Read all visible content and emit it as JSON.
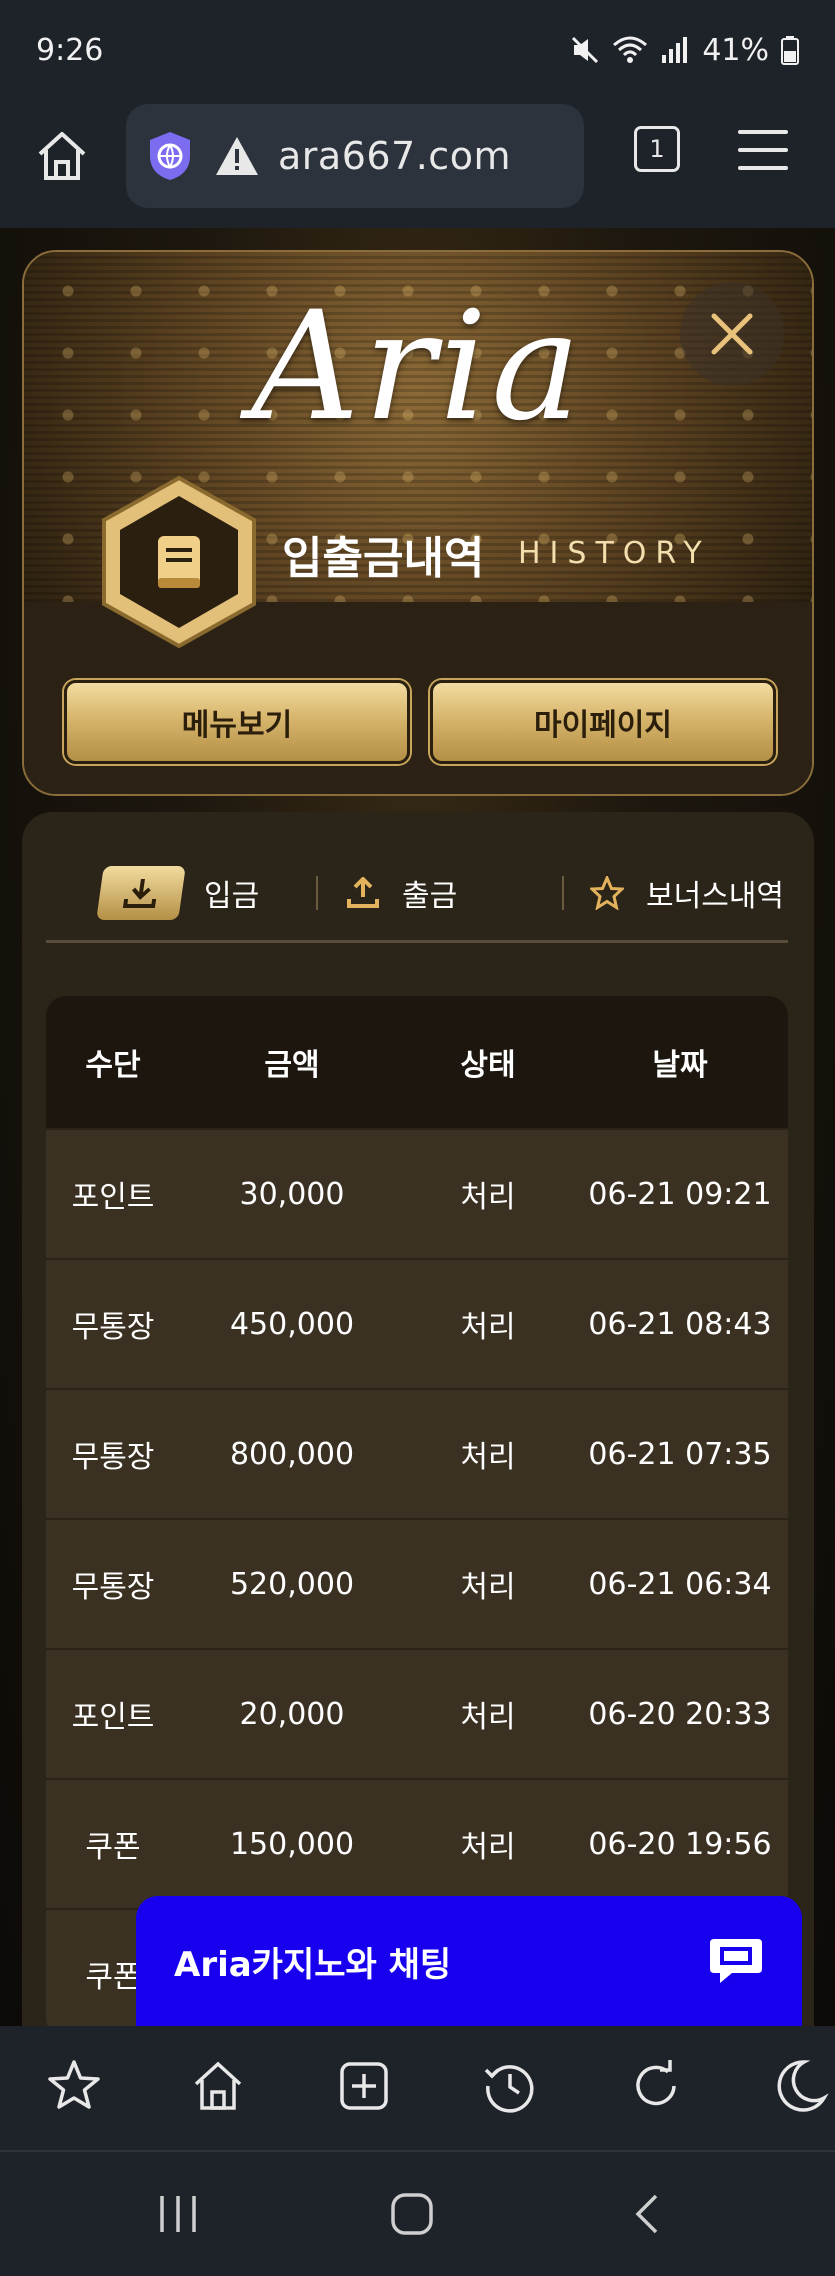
{
  "status_bar": {
    "time": "9:26",
    "battery": "41%"
  },
  "browser": {
    "url": "ara667.com",
    "tab_count": "1"
  },
  "header": {
    "logo_text": "Aria",
    "title": "입출금내역",
    "subtitle": "HISTORY",
    "menu_button": "메뉴보기",
    "mypage_button": "마이페이지"
  },
  "tabs": {
    "deposit": "입금",
    "withdraw": "출금",
    "bonus": "보너스내역"
  },
  "table": {
    "headers": [
      "수단",
      "금액",
      "상태",
      "날짜"
    ],
    "rows": [
      [
        "포인트",
        "30,000",
        "처리",
        "06-21 09:21"
      ],
      [
        "무통장",
        "450,000",
        "처리",
        "06-21 08:43"
      ],
      [
        "무통장",
        "800,000",
        "처리",
        "06-21 07:35"
      ],
      [
        "무통장",
        "520,000",
        "처리",
        "06-21 06:34"
      ],
      [
        "포인트",
        "20,000",
        "처리",
        "06-20 20:33"
      ],
      [
        "쿠폰",
        "150,000",
        "처리",
        "06-20 19:56"
      ],
      [
        "쿠폰",
        "",
        "",
        ""
      ]
    ]
  },
  "chat": {
    "label": "Aria카지노와 채팅"
  },
  "colors": {
    "accent_gold": "#d7b56c",
    "chat_blue": "#1800ee"
  }
}
